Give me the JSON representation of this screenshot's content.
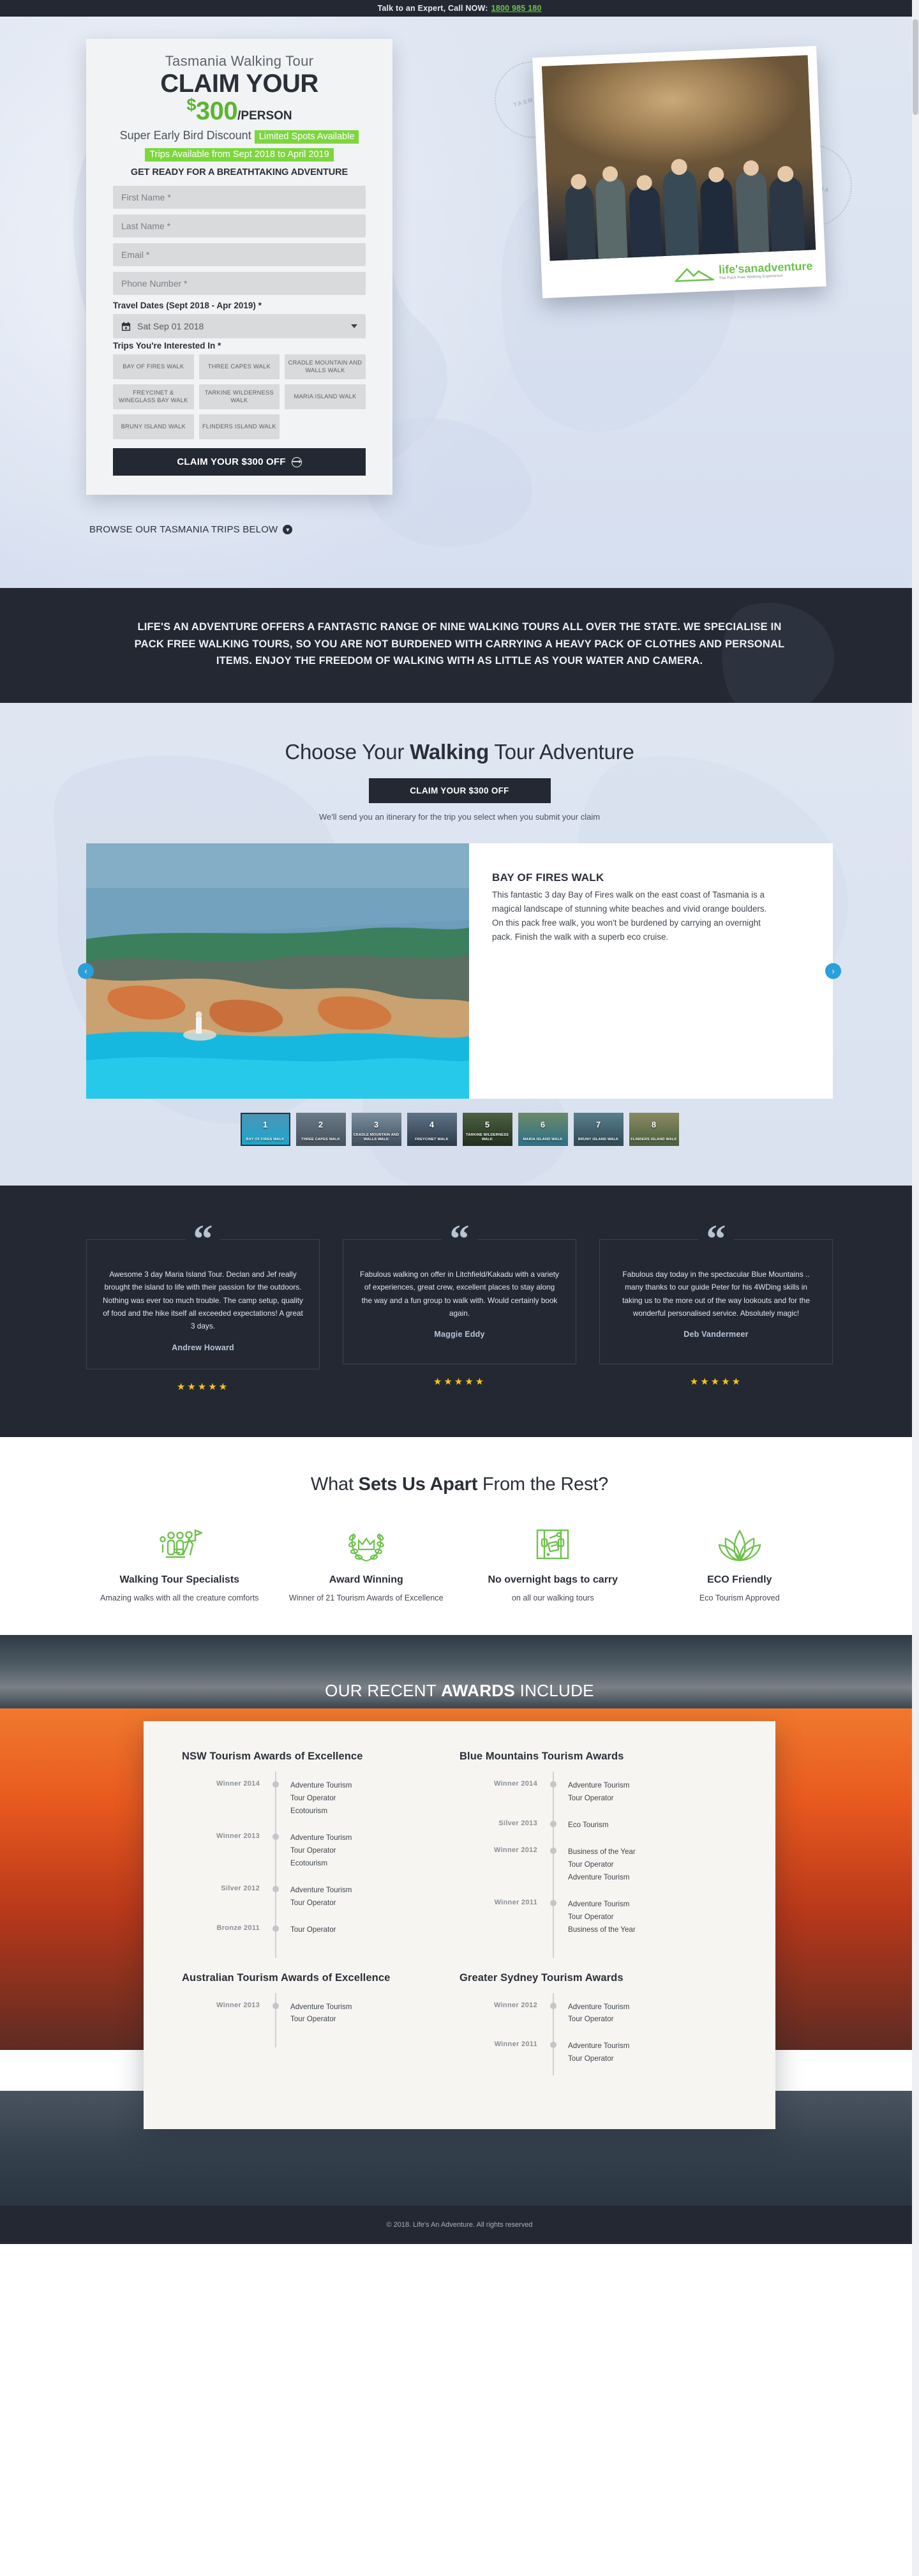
{
  "topbar": {
    "text": "Talk to an Expert, Call NOW:",
    "phone": "1800 985 180"
  },
  "hero": {
    "form": {
      "kicker": "Tasmania Walking Tour",
      "headline_1": "CLAIM YOUR",
      "dollar": "$",
      "amount": "300",
      "per": "/PERSON",
      "discount_label": "Super Early Bird Discount",
      "badge_spots": "Limited Spots Available",
      "badge_dates": "Trips Available from Sept 2018 to April 2019",
      "ready_line": "GET READY FOR A BREATHTAKING ADVENTURE",
      "first_name_placeholder": "First Name *",
      "last_name_placeholder": "Last Name *",
      "email_placeholder": "Email *",
      "phone_placeholder": "Phone Number *",
      "travel_dates_label": "Travel Dates (Sept 2018 - Apr 2019) *",
      "travel_date_value": "Sat Sep 01 2018",
      "trips_label": "Trips You're Interested In *",
      "trip_chips": [
        "BAY OF FIRES WALK",
        "THREE CAPES WALK",
        "CRADLE MOUNTAIN AND WALLS WALK",
        "FREYCINET & WINEGLASS BAY WALK",
        "TARKINE WILDERNESS WALK",
        "MARIA ISLAND WALK",
        "BRUNY ISLAND WALK",
        "FLINDERS ISLAND WALK"
      ],
      "submit_label": "CLAIM YOUR $300 OFF"
    },
    "browse_label": "BROWSE OUR TASMANIA TRIPS BELOW",
    "logo_main": "life's",
    "logo_accent": "anadventure",
    "logo_tagline": "The Pack Free Walking Experience",
    "stamp_left": "TASMANIA",
    "stamp_right": "TASMANIA"
  },
  "band": {
    "text": "LIFE'S AN ADVENTURE OFFERS A FANTASTIC RANGE OF NINE WALKING TOURS ALL OVER THE STATE. WE SPECIALISE IN PACK FREE WALKING TOURS, SO YOU ARE NOT BURDENED WITH CARRYING A HEAVY PACK OF CLOTHES AND PERSONAL ITEMS. ENJOY THE FREEDOM OF WALKING WITH AS LITTLE AS YOUR WATER AND CAMERA."
  },
  "choose": {
    "title_pre": "Choose Your ",
    "title_bold": "Walking",
    "title_post": " Tour Adventure",
    "cta_label": "CLAIM YOUR $300 OFF",
    "note": "We'll send you an itinerary for the trip you select when you submit your claim",
    "slide": {
      "title": "BAY OF FIRES WALK",
      "body": "This fantastic 3 day Bay of Fires walk on the east coast of Tasmania is a magical landscape of stunning white beaches and vivid orange boulders. On this pack free walk, you won't be burdened by carrying an overnight pack. Finish the walk with a superb eco cruise."
    },
    "prev_label": "‹",
    "next_label": "›",
    "thumbs": [
      {
        "no": "1",
        "label": "BAY OF FIRES WALK"
      },
      {
        "no": "2",
        "label": "THREE CAPES WALK"
      },
      {
        "no": "3",
        "label": "CRADLE MOUNTAIN AND WALLS WALK"
      },
      {
        "no": "4",
        "label": "FREYCINET WALK"
      },
      {
        "no": "5",
        "label": "TARKINE WILDERNESS WALK"
      },
      {
        "no": "6",
        "label": "MARIA ISLAND WALK"
      },
      {
        "no": "7",
        "label": "BRUNY ISLAND WALK"
      },
      {
        "no": "8",
        "label": "FLINDERS ISLAND WALK"
      }
    ]
  },
  "testimonials": [
    {
      "quote": "Awesome 3 day Maria Island Tour. Declan and Jef really brought the island to life with their passion for the outdoors. Nothing was ever too much trouble. The camp setup, quality of food and the hike itself all exceeded expectations! A great 3 days.",
      "name": "Andrew Howard",
      "stars": "★★★★★"
    },
    {
      "quote": "Fabulous walking on offer in Litchfield/Kakadu with a variety of experiences, great crew, excellent places to stay along the way and a fun group to walk with. Would certainly book again.",
      "name": "Maggie Eddy",
      "stars": "★★★★★"
    },
    {
      "quote": "Fabulous day today in the spectacular Blue Mountains .. many thanks to our guide Peter for his 4WDing skills in taking us to the more out of the way lookouts and for the wonderful personalised service. Absolutely magic!",
      "name": "Deb Vandermeer",
      "stars": "★★★★★"
    }
  ],
  "apart": {
    "title_pre": "What ",
    "title_bold": "Sets Us Apart",
    "title_post": " From the Rest?",
    "features": [
      {
        "icon": "walking-group-icon",
        "title": "Walking Tour Specialists",
        "desc": "Amazing walks with all the creature comforts"
      },
      {
        "icon": "laurel-crown-icon",
        "title": "Award Winning",
        "desc": "Winner of 21 Tourism Awards of Excellence"
      },
      {
        "icon": "backpack-icon",
        "title": "No overnight bags to carry",
        "desc": "on all our walking tours"
      },
      {
        "icon": "lotus-leaf-icon",
        "title": "ECO Friendly",
        "desc": "Eco Tourism Approved"
      }
    ]
  },
  "awards": {
    "title_pre": "OUR RECENT ",
    "title_bold": "AWARDS",
    "title_post": " INCLUDE",
    "columns": [
      {
        "title": "NSW Tourism Awards of Excellence",
        "rows": [
          {
            "year": "Winner 2014",
            "items": [
              "Adventure Tourism",
              "Tour Operator",
              "Ecotourism"
            ]
          },
          {
            "year": "Winner 2013",
            "items": [
              "Adventure Tourism",
              "Tour Operator",
              "Ecotourism"
            ]
          },
          {
            "year": "Silver 2012",
            "items": [
              "Adventure Tourism",
              "Tour Operator"
            ]
          },
          {
            "year": "Bronze 2011",
            "items": [
              "Tour Operator"
            ]
          }
        ]
      },
      {
        "title": "Blue Mountains Tourism Awards",
        "rows": [
          {
            "year": "Winner 2014",
            "items": [
              "Adventure Tourism",
              "Tour Operator"
            ]
          },
          {
            "year": "Silver 2013",
            "items": [
              "Eco Tourism"
            ]
          },
          {
            "year": "Winner 2012",
            "items": [
              "Business of the Year",
              "Tour Operator",
              "Adventure Tourism"
            ]
          },
          {
            "year": "Winner 2011",
            "items": [
              "Adventure Tourism",
              "Tour Operator",
              "Business of the Year"
            ]
          }
        ]
      },
      {
        "title": "Australian Tourism Awards of Excellence",
        "rows": [
          {
            "year": "Winner 2013",
            "items": [
              "Adventure Tourism",
              "Tour Operator"
            ]
          }
        ]
      },
      {
        "title": "Greater Sydney Tourism Awards",
        "rows": [
          {
            "year": "Winner 2012",
            "items": [
              "Adventure Tourism",
              "Tour Operator"
            ]
          },
          {
            "year": "Winner 2011",
            "items": [
              "Adventure Tourism",
              "Tour Operator"
            ]
          }
        ]
      }
    ]
  },
  "footer": {
    "copyright": "© 2018. Life's An Adventure. All rights reserved"
  },
  "colors": {
    "accent_green": "#6dc24b",
    "dark": "#232832",
    "badge_green": "#7ed63f",
    "carousel_blue": "#2a9fd8",
    "star_gold": "#f5c518"
  }
}
